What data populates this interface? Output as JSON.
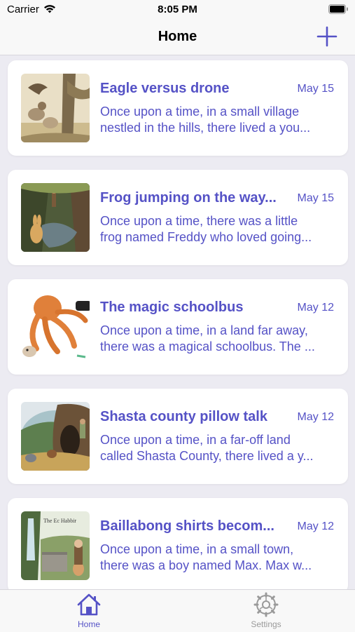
{
  "status_bar": {
    "carrier": "Carrier",
    "time": "8:05 PM"
  },
  "nav": {
    "title": "Home",
    "add_icon": "plus-icon"
  },
  "colors": {
    "accent": "#5552c6",
    "background": "#ecebf2",
    "card": "#ffffff",
    "inactive": "#9a9a9a"
  },
  "stories": [
    {
      "title": "Eagle versus drone",
      "date": "May 15",
      "excerpt_line1": "Once upon a time, in a small village",
      "excerpt_line2": "nestled in the hills, there lived a you...",
      "thumbnail": "eagle-illustration"
    },
    {
      "title": "Frog jumping on the way...",
      "date": "May 15",
      "excerpt_line1": "Once upon a time, there was a little",
      "excerpt_line2": "frog named Freddy who loved going...",
      "thumbnail": "forest-rabbit-illustration"
    },
    {
      "title": "The magic schoolbus",
      "date": "May 12",
      "excerpt_line1": "Once upon a time, in a land far away,",
      "excerpt_line2": "there was a magical schoolbus. The ...",
      "thumbnail": "octopus-illustration"
    },
    {
      "title": "Shasta county pillow talk",
      "date": "May 12",
      "excerpt_line1": "Once upon a time, in a far-off land",
      "excerpt_line2": "called Shasta County, there lived a y...",
      "thumbnail": "tree-hollow-illustration"
    },
    {
      "title": "Baillabong shirts becom...",
      "date": "May 12",
      "excerpt_line1": "Once upon a time, in a small town,",
      "excerpt_line2": "there was a boy named Max. Max w...",
      "thumbnail": "waterfall-illustration",
      "thumbnail_caption": "The Ec Habbir"
    }
  ],
  "tabs": [
    {
      "label": "Home",
      "icon": "house-icon",
      "selected": true
    },
    {
      "label": "Settings",
      "icon": "gear-icon",
      "selected": false
    }
  ]
}
